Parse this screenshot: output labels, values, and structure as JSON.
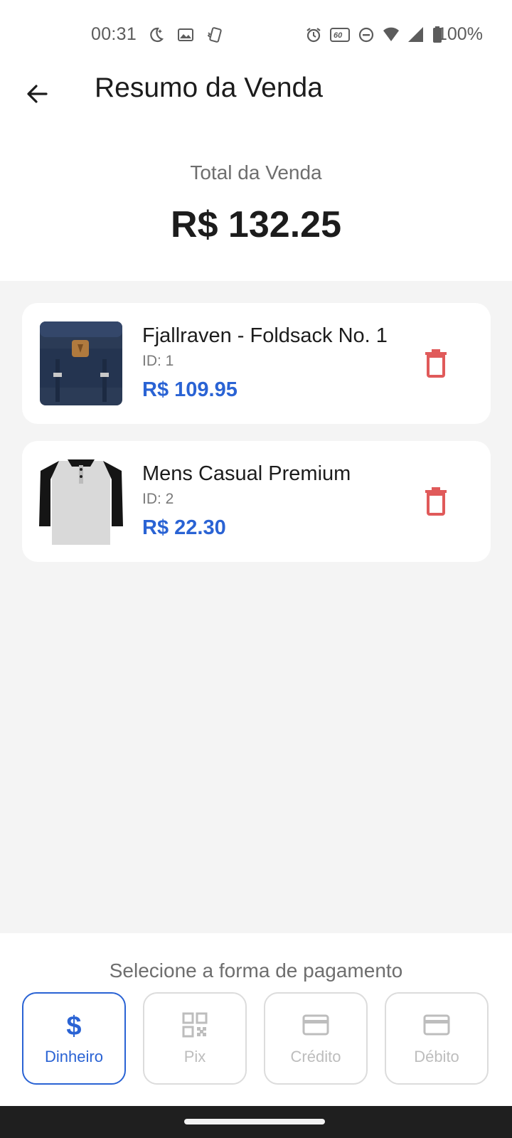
{
  "status_bar": {
    "time": "00:31",
    "battery_text": "100%",
    "left_icons": [
      "night-mode-icon",
      "gallery-icon",
      "phone-vibrate-icon"
    ],
    "right_icons": [
      "alarm-icon",
      "refresh-rate-icon",
      "do-not-disturb-icon",
      "wifi-icon",
      "signal-icon",
      "battery-icon"
    ]
  },
  "app_bar": {
    "title": "Resumo da Venda",
    "back_icon": "arrow-left-icon"
  },
  "summary": {
    "total_label": "Total da Venda",
    "total_value": "R$ 132.25"
  },
  "items": [
    {
      "name": "Fjallraven - Foldsack No. 1",
      "id": "ID: 1",
      "price": "R$ 109.95",
      "image": "backpack-image",
      "delete_icon": "trash-icon"
    },
    {
      "name": "Mens Casual Premium",
      "id": "ID: 2",
      "price": "R$ 22.30",
      "image": "tshirt-image",
      "delete_icon": "trash-icon"
    }
  ],
  "payment": {
    "label": "Selecione a forma de pagamento",
    "options": [
      {
        "label": "Dinheiro",
        "icon": "dollar-icon",
        "selected": true
      },
      {
        "label": "Pix",
        "icon": "qr-code-icon",
        "selected": false
      },
      {
        "label": "Crédito",
        "icon": "credit-card-icon",
        "selected": false
      },
      {
        "label": "Débito",
        "icon": "credit-card-icon",
        "selected": false
      }
    ]
  },
  "colors": {
    "accent": "#2a63d4",
    "delete": "#e05a5a",
    "list_background": "#f4f4f4"
  }
}
